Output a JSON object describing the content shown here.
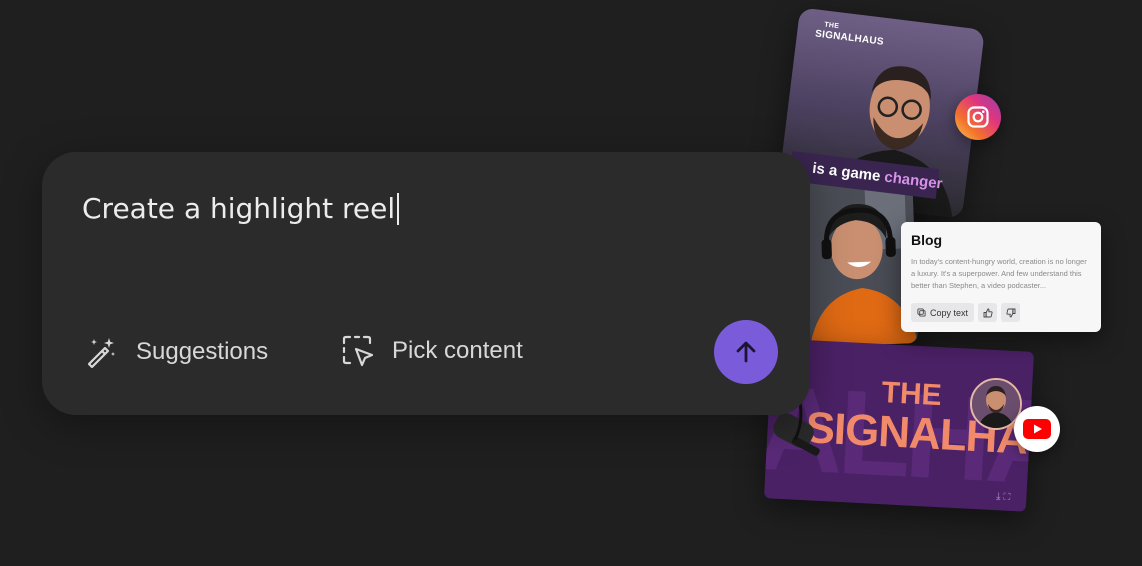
{
  "prompt": {
    "value": "Create a highlight reel"
  },
  "actions": {
    "suggestions_label": "Suggestions",
    "pick_content_label": "Pick content",
    "send_icon": "arrow-up-icon"
  },
  "collage": {
    "instagram_card": {
      "brand_the": "THE",
      "brand_name": "SIGNALHAUS"
    },
    "banner": {
      "text_prefix": "is a",
      "text_game": "game",
      "text_suffix": "changer"
    },
    "blog_card": {
      "title": "Blog",
      "body": "In today's content-hungry world, creation is no longer a luxury. It's a superpower. And few understand this better than Stephen, a video podcaster...",
      "copy_label": "Copy text"
    },
    "youtube_card": {
      "the": "THE",
      "title": "SIGNALHAUS"
    }
  },
  "colors": {
    "background": "#1f1f1f",
    "panel": "#2b2b2b",
    "accent": "#7a5cdb",
    "youtube_red": "#ff0000"
  }
}
